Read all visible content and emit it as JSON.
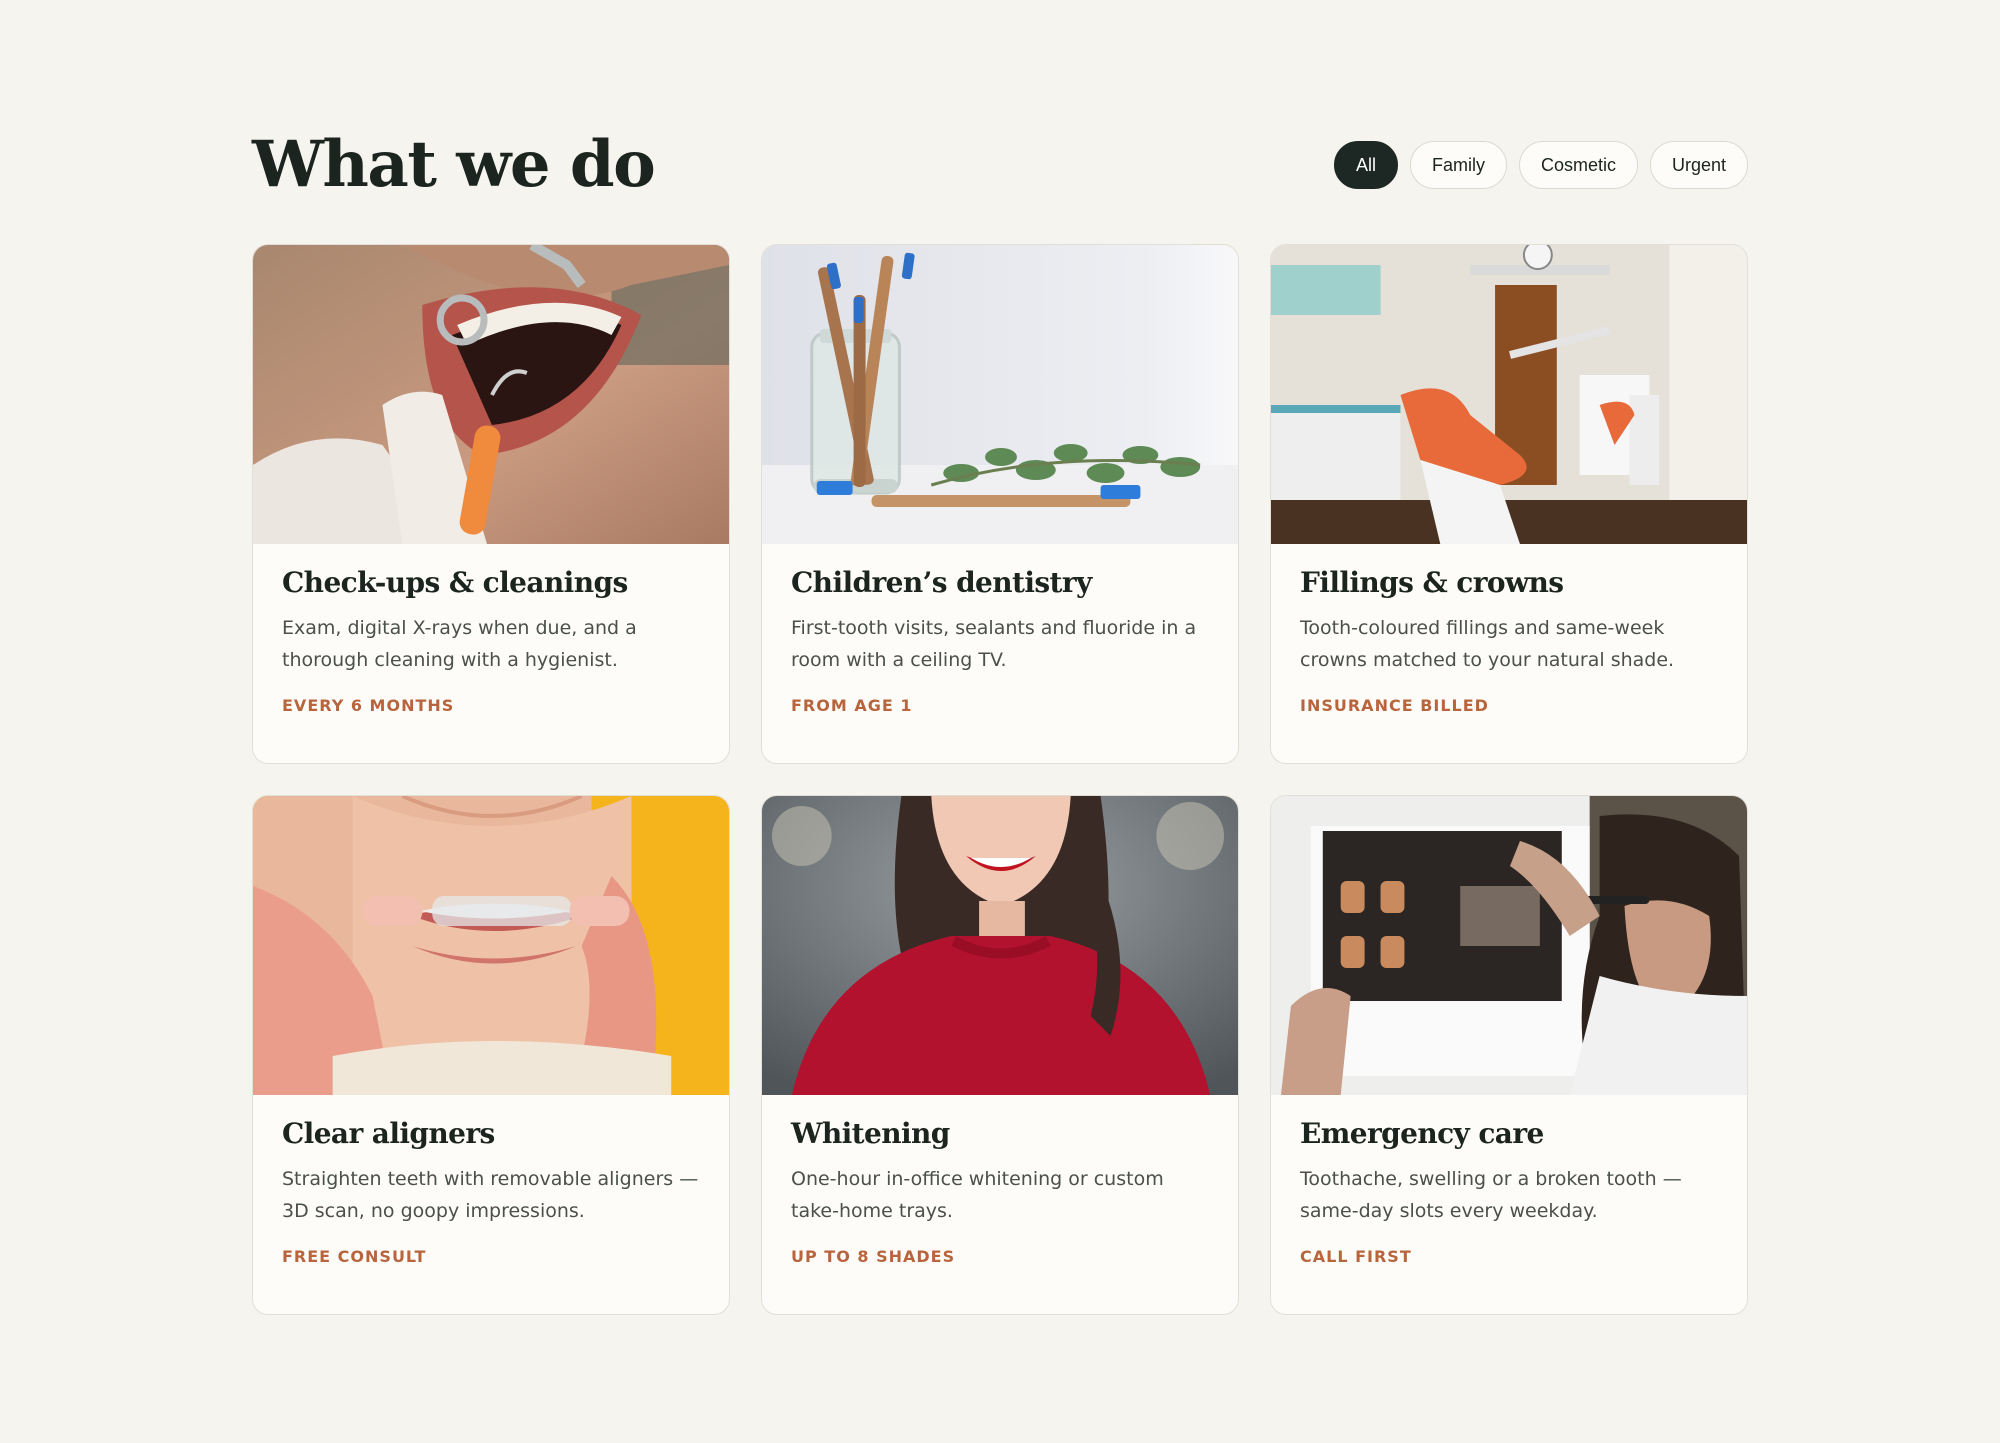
{
  "section": {
    "title": "What we do"
  },
  "filters": [
    {
      "label": "All",
      "active": true
    },
    {
      "label": "Family",
      "active": false
    },
    {
      "label": "Cosmetic",
      "active": false
    },
    {
      "label": "Urgent",
      "active": false
    }
  ],
  "services": [
    {
      "title": "Check-ups & cleanings",
      "description": "Exam, digital X-rays when due, and a thorough cleaning with a hygienist.",
      "tag": "EVERY 6 MONTHS",
      "image": "dental-exam-photo"
    },
    {
      "title": "Children’s dentistry",
      "description": "First-tooth visits, sealants and fluoride in a room with a ceiling TV.",
      "tag": "FROM AGE 1",
      "image": "bamboo-toothbrushes-photo"
    },
    {
      "title": "Fillings & crowns",
      "description": "Tooth-coloured fillings and same-week crowns matched to your natural shade.",
      "tag": "INSURANCE BILLED",
      "image": "dental-office-chair-photo"
    },
    {
      "title": "Clear aligners",
      "description": "Straighten teeth with removable aligners — 3D scan, no goopy impressions.",
      "tag": "FREE CONSULT",
      "image": "clear-aligner-photo"
    },
    {
      "title": "Whitening",
      "description": "One-hour in-office whitening or custom take-home trays.",
      "tag": "UP TO 8 SHADES",
      "image": "smiling-woman-photo"
    },
    {
      "title": "Emergency care",
      "description": "Toothache, swelling or a broken tooth — same-day slots every weekday.",
      "tag": "CALL FIRST",
      "image": "dentist-xray-photo"
    }
  ],
  "colors": {
    "background": "#f6f4ef",
    "card": "#fdfcf8",
    "active_chip": "#1d2824",
    "accent": "#b8653d"
  }
}
